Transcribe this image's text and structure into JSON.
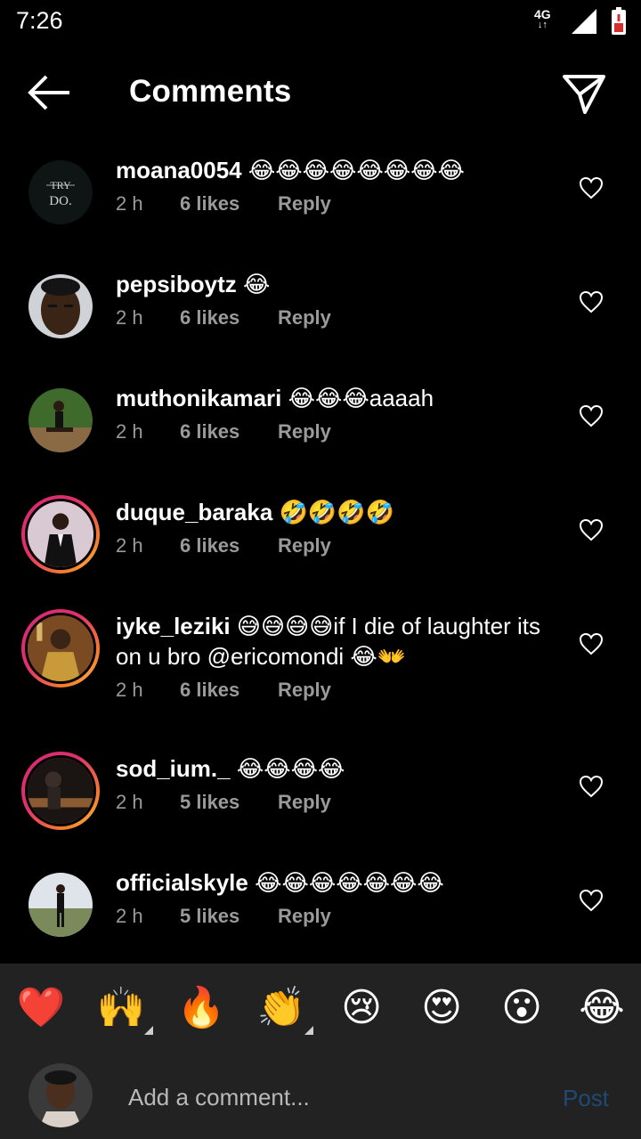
{
  "status_bar": {
    "time": "7:26",
    "network": "4G",
    "network_arrows": "↓↑"
  },
  "header": {
    "title": "Comments"
  },
  "comments": [
    {
      "user": "moana0054",
      "text": " 😂😂😂😂😂😂😂😂",
      "age": "2 h",
      "likes": "6 likes",
      "reply": "Reply"
    },
    {
      "user": "pepsiboytz",
      "text": " 😂",
      "age": "2 h",
      "likes": "6 likes",
      "reply": "Reply"
    },
    {
      "user": "muthonikamari",
      "text": " 😂😂😂aaaah",
      "age": "2 h",
      "likes": "6 likes",
      "reply": "Reply"
    },
    {
      "user": "duque_baraka",
      "text": " 🤣🤣🤣🤣",
      "age": "2 h",
      "likes": "6 likes",
      "reply": "Reply"
    },
    {
      "user": "iyke_leziki",
      "text": " 😅😅😅😅if I die of laughter its on u bro @ericomondi 😂👐",
      "age": "2 h",
      "likes": "6 likes",
      "reply": "Reply"
    },
    {
      "user": "sod_ium._",
      "text": " 😂😂😂😂",
      "age": "2 h",
      "likes": "5 likes",
      "reply": "Reply"
    },
    {
      "user": "officialskyle",
      "text": " 😂😂😂😂😂😂😂",
      "age": "2 h",
      "likes": "5 likes",
      "reply": "Reply"
    }
  ],
  "avatar_logo_text": {
    "line1": "TRY",
    "line2": "DO."
  },
  "reactions": [
    "❤️",
    "🙌",
    "🔥",
    "👏",
    "😢",
    "😍",
    "😮",
    "😂"
  ],
  "composer": {
    "placeholder": "Add a comment...",
    "post_label": "Post"
  },
  "colors": {
    "background": "#000000",
    "tray": "#222222",
    "meta_text": "#9a9a9a",
    "post_disabled": "#1f4a74",
    "story_ring_start": "#d62976",
    "story_ring_end": "#feda75"
  }
}
